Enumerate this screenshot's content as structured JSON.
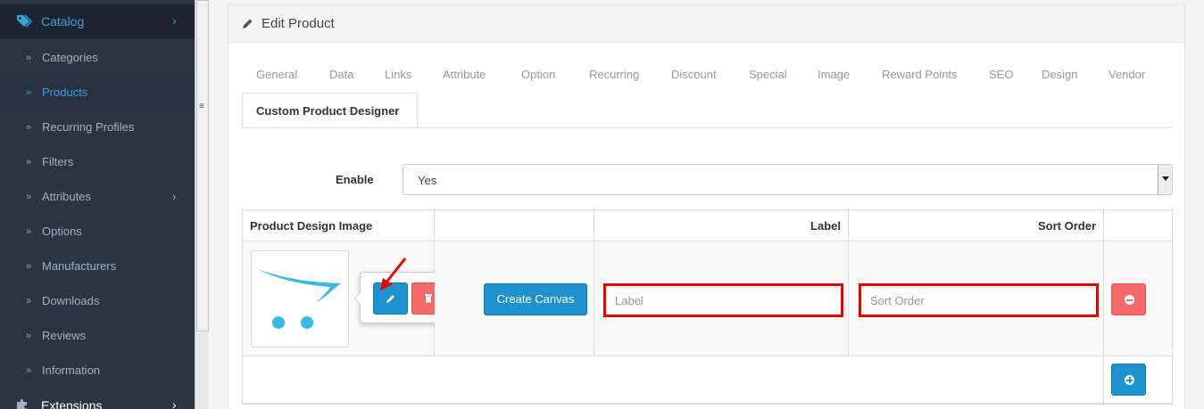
{
  "sidebar": {
    "top": {
      "label": "Catalog",
      "icon": "tag-icon"
    },
    "items": [
      {
        "label": "Categories",
        "active": false
      },
      {
        "label": "Products",
        "active": true
      },
      {
        "label": "Recurring Profiles",
        "active": false
      },
      {
        "label": "Filters",
        "active": false
      },
      {
        "label": "Attributes",
        "active": false,
        "has_children": true
      },
      {
        "label": "Options",
        "active": false
      },
      {
        "label": "Manufacturers",
        "active": false
      },
      {
        "label": "Downloads",
        "active": false
      },
      {
        "label": "Reviews",
        "active": false
      },
      {
        "label": "Information",
        "active": false
      }
    ],
    "extensions": {
      "label": "Extensions",
      "icon": "puzzle-icon"
    }
  },
  "panel": {
    "title": "Edit Product",
    "tabs": [
      "General",
      "Data",
      "Links",
      "Attribute",
      "Option",
      "Recurring",
      "Discount",
      "Special",
      "Image",
      "Reward Points",
      "SEO",
      "Design",
      "Vendor"
    ],
    "active_tab": "Custom Product Designer"
  },
  "form": {
    "enable_label": "Enable",
    "enable_value": "Yes"
  },
  "table": {
    "headers": [
      "Product Design Image",
      "",
      "Label",
      "Sort Order",
      ""
    ],
    "create_canvas_label": "Create Canvas",
    "label_placeholder": "Label",
    "sort_order_placeholder": "Sort Order"
  },
  "colors": {
    "sidebar_bg": "#2b3542",
    "active_link": "#35a3de",
    "primary": "#1e91cf",
    "danger": "#f56b6b",
    "highlight": "#e50000"
  }
}
